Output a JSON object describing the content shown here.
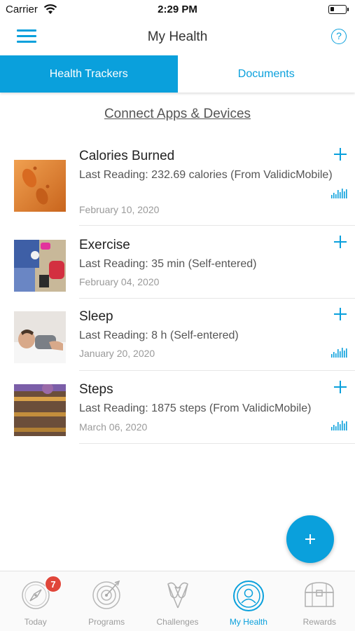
{
  "status_bar": {
    "carrier": "Carrier",
    "time": "2:29 PM"
  },
  "nav": {
    "title": "My Health",
    "help_symbol": "?"
  },
  "tabs": [
    {
      "label": "Health Trackers",
      "active": true
    },
    {
      "label": "Documents",
      "active": false
    }
  ],
  "connect_link": "Connect Apps & Devices",
  "trackers": [
    {
      "title": "Calories Burned",
      "reading": "Last Reading: 232.69 calories (From ValidicMobile)",
      "date": "February 10, 2020",
      "icon": "chart-icon",
      "has_chart": true
    },
    {
      "title": "Exercise",
      "reading": "Last Reading: 35 min (Self-entered)",
      "date": "February 04, 2020",
      "has_chart": false
    },
    {
      "title": "Sleep",
      "reading": "Last Reading: 8 h (Self-entered)",
      "date": "January 20, 2020",
      "has_chart": true
    },
    {
      "title": "Steps",
      "reading": "Last Reading: 1875 steps (From ValidicMobile)",
      "date": "March 06, 2020",
      "has_chart": true
    }
  ],
  "fab": {
    "icon": "plus-icon"
  },
  "tab_bar": [
    {
      "label": "Today",
      "icon": "compass-icon",
      "badge": "7",
      "active": false
    },
    {
      "label": "Programs",
      "icon": "target-icon",
      "active": false
    },
    {
      "label": "Challenges",
      "icon": "flags-icon",
      "active": false
    },
    {
      "label": "My Health",
      "icon": "person-icon",
      "active": true
    },
    {
      "label": "Rewards",
      "icon": "treasure-chest-icon",
      "active": false
    }
  ],
  "colors": {
    "accent": "#0aa0dc",
    "badge": "#e0463a"
  }
}
